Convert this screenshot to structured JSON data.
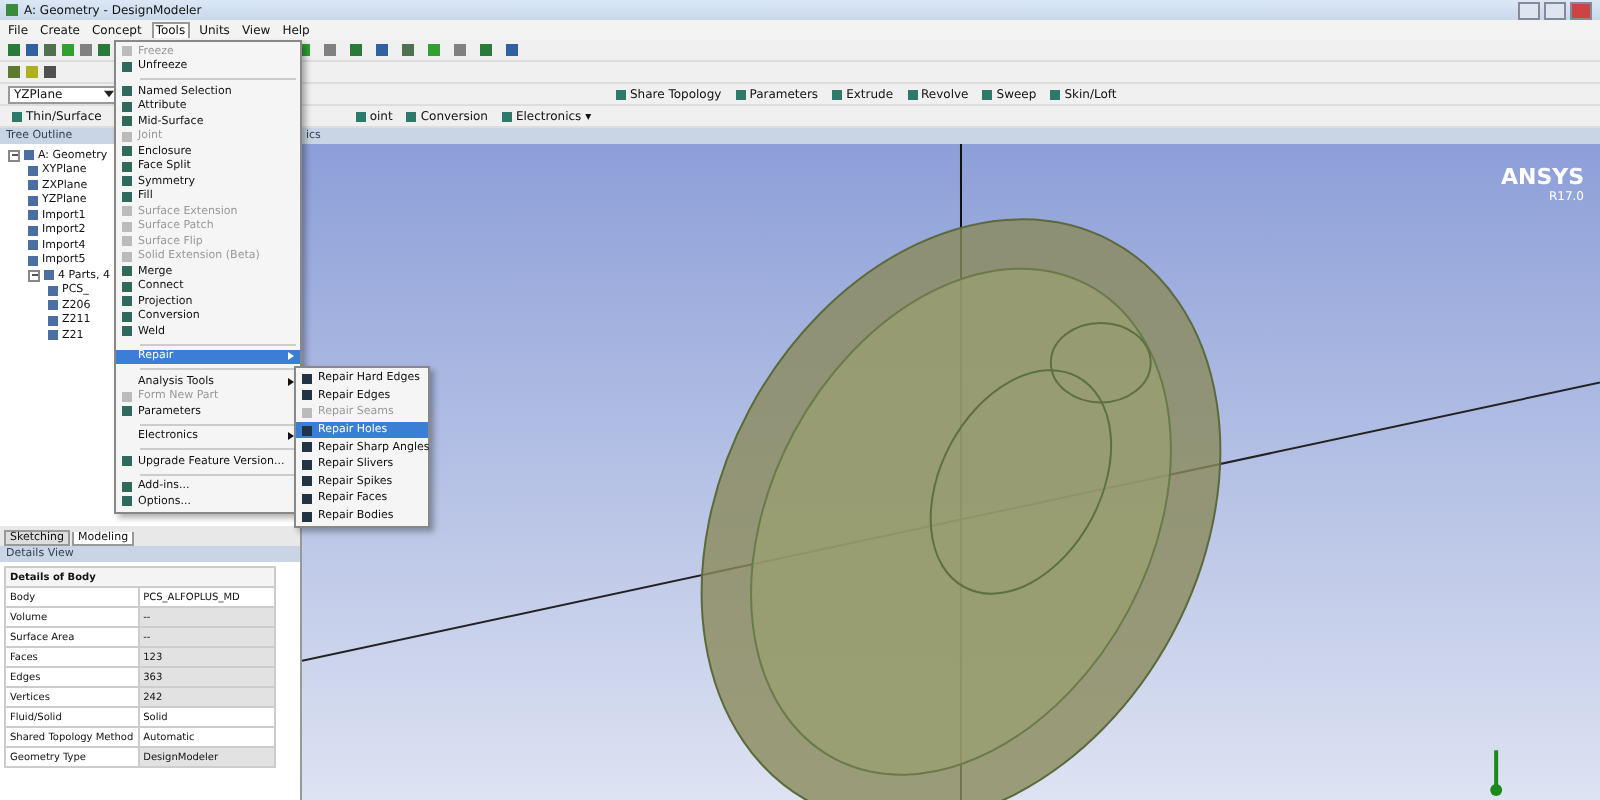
{
  "window": {
    "title": "A: Geometry - DesignModeler"
  },
  "menu_bar": [
    {
      "label": "File",
      "selected": false
    },
    {
      "label": "Create",
      "selected": false
    },
    {
      "label": "Concept",
      "selected": false
    },
    {
      "label": "Tools",
      "selected": true
    },
    {
      "label": "Units",
      "selected": false
    },
    {
      "label": "View",
      "selected": false
    },
    {
      "label": "Help",
      "selected": false
    }
  ],
  "toolbar": {
    "plane_select": "YZPlane",
    "row_3": [
      "Share Topology",
      "Parameters",
      "Extrude",
      "Revolve",
      "Sweep",
      "Skin/Loft"
    ],
    "row_4": [
      "Thin/Surface",
      "oint",
      "Conversion",
      "Electronics ▾"
    ]
  },
  "tree_outline": {
    "title": "Tree Outline",
    "items": [
      {
        "label": "A: Geometry",
        "expanded": true,
        "children": [
          {
            "label": "XYPlane"
          },
          {
            "label": "ZXPlane"
          },
          {
            "label": "YZPlane"
          },
          {
            "label": "Import1"
          },
          {
            "label": "Import2"
          },
          {
            "label": "Import4"
          },
          {
            "label": "Import5"
          },
          {
            "label": "4 Parts, 4",
            "expanded": true,
            "children": [
              {
                "label": "PCS_"
              },
              {
                "label": "Z206"
              },
              {
                "label": "Z211"
              },
              {
                "label": "Z21"
              }
            ]
          }
        ]
      }
    ]
  },
  "bottom_tabs": [
    {
      "label": "Sketching",
      "selected": false
    },
    {
      "label": "Modeling",
      "selected": true
    }
  ],
  "details_view": {
    "title": "Details View",
    "section": "Details of Body",
    "rows": [
      {
        "property": "Body",
        "value": "PCS_ALFOPLUS_MD",
        "readonly": false
      },
      {
        "property": "Volume",
        "value": "--",
        "readonly": true
      },
      {
        "property": "Surface Area",
        "value": "--",
        "readonly": true
      },
      {
        "property": "Faces",
        "value": "123",
        "readonly": true
      },
      {
        "property": "Edges",
        "value": "363",
        "readonly": true
      },
      {
        "property": "Vertices",
        "value": "242",
        "readonly": true
      },
      {
        "property": "Fluid/Solid",
        "value": "Solid",
        "readonly": false
      },
      {
        "property": "Shared Topology Method",
        "value": "Automatic",
        "readonly": false
      },
      {
        "property": "Geometry Type",
        "value": "DesignModeler",
        "readonly": true
      }
    ]
  },
  "graphics": {
    "title": "ics",
    "logo": "ANSYS",
    "version": "R17.0"
  },
  "tools_menu": [
    {
      "kind": "item",
      "label": "Freeze",
      "disabled": true,
      "selected": false,
      "submenu": false
    },
    {
      "kind": "item",
      "label": "Unfreeze",
      "disabled": false,
      "selected": false,
      "submenu": false
    },
    {
      "kind": "separator"
    },
    {
      "kind": "item",
      "label": "Named Selection",
      "disabled": false,
      "selected": false,
      "submenu": false
    },
    {
      "kind": "item",
      "label": "Attribute",
      "disabled": false,
      "selected": false,
      "submenu": false
    },
    {
      "kind": "item",
      "label": "Mid-Surface",
      "disabled": false,
      "selected": false,
      "submenu": false
    },
    {
      "kind": "item",
      "label": "Joint",
      "disabled": true,
      "selected": false,
      "submenu": false
    },
    {
      "kind": "item",
      "label": "Enclosure",
      "disabled": false,
      "selected": false,
      "submenu": false
    },
    {
      "kind": "item",
      "label": "Face Split",
      "disabled": false,
      "selected": false,
      "submenu": false
    },
    {
      "kind": "item",
      "label": "Symmetry",
      "disabled": false,
      "selected": false,
      "submenu": false
    },
    {
      "kind": "item",
      "label": "Fill",
      "disabled": false,
      "selected": false,
      "submenu": false
    },
    {
      "kind": "item",
      "label": "Surface Extension",
      "disabled": true,
      "selected": false,
      "submenu": false
    },
    {
      "kind": "item",
      "label": "Surface Patch",
      "disabled": true,
      "selected": false,
      "submenu": false
    },
    {
      "kind": "item",
      "label": "Surface Flip",
      "disabled": true,
      "selected": false,
      "submenu": false
    },
    {
      "kind": "item",
      "label": "Solid Extension (Beta)",
      "disabled": true,
      "selected": false,
      "submenu": false
    },
    {
      "kind": "item",
      "label": "Merge",
      "disabled": false,
      "selected": false,
      "submenu": false
    },
    {
      "kind": "item",
      "label": "Connect",
      "disabled": false,
      "selected": false,
      "submenu": false
    },
    {
      "kind": "item",
      "label": "Projection",
      "disabled": false,
      "selected": false,
      "submenu": false
    },
    {
      "kind": "item",
      "label": "Conversion",
      "disabled": false,
      "selected": false,
      "submenu": false
    },
    {
      "kind": "item",
      "label": "Weld",
      "disabled": false,
      "selected": false,
      "submenu": false
    },
    {
      "kind": "separator"
    },
    {
      "kind": "item",
      "label": "Repair",
      "disabled": false,
      "selected": true,
      "submenu": true
    },
    {
      "kind": "separator"
    },
    {
      "kind": "item",
      "label": "Analysis Tools",
      "disabled": false,
      "selected": false,
      "submenu": true
    },
    {
      "kind": "item",
      "label": "Form New Part",
      "disabled": true,
      "selected": false,
      "submenu": false
    },
    {
      "kind": "item",
      "label": "Parameters",
      "disabled": false,
      "selected": false,
      "submenu": false
    },
    {
      "kind": "separator"
    },
    {
      "kind": "item",
      "label": "Electronics",
      "disabled": false,
      "selected": false,
      "submenu": true
    },
    {
      "kind": "separator"
    },
    {
      "kind": "item",
      "label": "Upgrade Feature Version...",
      "disabled": false,
      "selected": false,
      "submenu": false
    },
    {
      "kind": "separator"
    },
    {
      "kind": "item",
      "label": "Add-ins...",
      "disabled": false,
      "selected": false,
      "submenu": false
    },
    {
      "kind": "item",
      "label": "Options...",
      "disabled": false,
      "selected": false,
      "submenu": false
    }
  ],
  "repair_submenu": [
    {
      "label": "Repair Hard Edges",
      "disabled": false,
      "selected": false
    },
    {
      "label": "Repair Edges",
      "disabled": false,
      "selected": false
    },
    {
      "label": "Repair Seams",
      "disabled": true,
      "selected": false
    },
    {
      "label": "Repair Holes",
      "disabled": false,
      "selected": true
    },
    {
      "label": "Repair Sharp Angles",
      "disabled": false,
      "selected": false
    },
    {
      "label": "Repair Slivers",
      "disabled": false,
      "selected": false
    },
    {
      "label": "Repair Spikes",
      "disabled": false,
      "selected": false
    },
    {
      "label": "Repair Faces",
      "disabled": false,
      "selected": false
    },
    {
      "label": "Repair Bodies",
      "disabled": false,
      "selected": false
    }
  ]
}
